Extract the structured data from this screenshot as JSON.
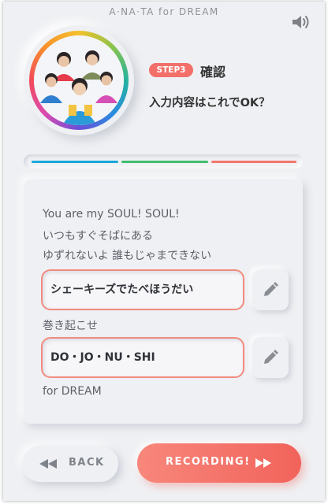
{
  "app": {
    "title": "A·NA·TA for DREAM"
  },
  "icons": {
    "sound": "speaker-icon",
    "edit": "pencil-icon",
    "back": "rewind-icon",
    "forward": "fast-forward-icon"
  },
  "step": {
    "badge": "STEP3",
    "title": "確認",
    "question": "入力内容はこれでOK？"
  },
  "progress": {
    "segments": [
      {
        "color": "#1aa9d8",
        "done": true
      },
      {
        "color": "#3fbf6e",
        "done": true
      },
      {
        "color": "#f2776b",
        "done": true
      }
    ]
  },
  "lyrics": {
    "line1": "You are my SOUL! SOUL!",
    "line2": "いつもすぐそばにある",
    "line3": "ゆずれないよ 誰もじゃまできない",
    "input1": "シェーキーズでたべほうだい",
    "line4": "巻き起こせ",
    "input2": "DO・JO・NU・SHI",
    "line5": "for DREAM"
  },
  "buttons": {
    "back": "BACK",
    "recording": "RECORDING!"
  },
  "colors": {
    "accent": "#f26f6a"
  }
}
